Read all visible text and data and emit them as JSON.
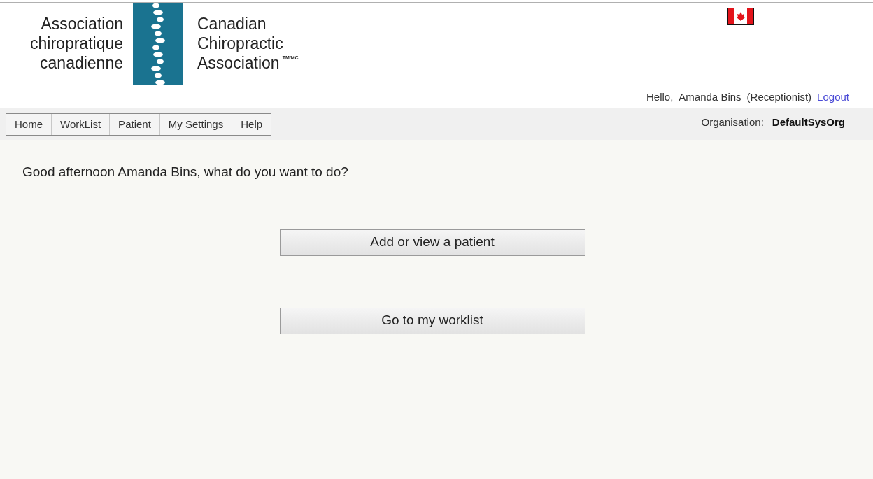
{
  "logo": {
    "french": [
      "Association",
      "chiropratique",
      "canadienne"
    ],
    "english": [
      "Canadian",
      "Chiropractic",
      "Association"
    ],
    "trademark": "TM/MC"
  },
  "user_bar": {
    "greeting": "Hello,",
    "name": "Amanda Bins",
    "role": "(Receptionist)",
    "logout": "Logout"
  },
  "menu": [
    {
      "label": "Home"
    },
    {
      "label": "WorkList"
    },
    {
      "label": "Patient"
    },
    {
      "label": "My Settings"
    },
    {
      "label": "Help"
    }
  ],
  "organisation": {
    "label": "Organisation:",
    "value": "DefaultSysOrg"
  },
  "welcome": "Good afternoon Amanda Bins, what do you want to do?",
  "actions": [
    "Add or view a patient",
    "Go to my worklist"
  ]
}
